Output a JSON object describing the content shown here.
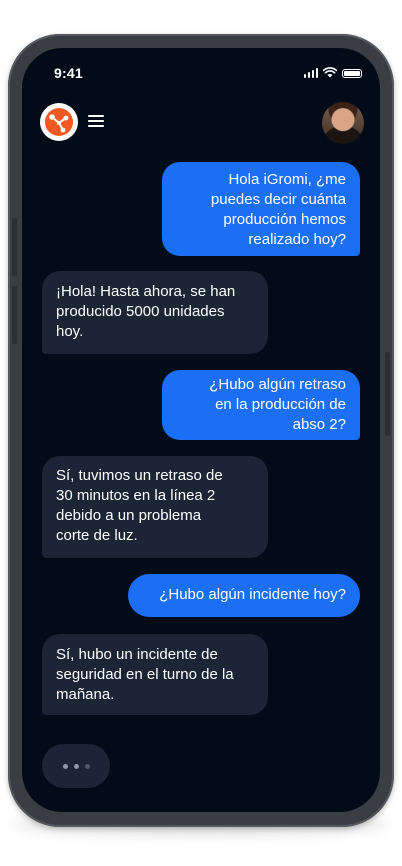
{
  "status_bar": {
    "time": "9:41"
  },
  "header": {
    "logo_icon": "igromi-logo-icon",
    "menu_icon": "hamburger-menu-icon",
    "avatar_icon": "user-avatar"
  },
  "colors": {
    "user_bubble": "#1b6ff5",
    "bot_bubble": "#1b2536",
    "screen_bg": "#020c18",
    "logo_accent": "#f05a22"
  },
  "messages": [
    {
      "sender": "user",
      "text": "Hola iGromi, ¿me\npuedes decir cuánta\nproducción hemos\nrealizado hoy?"
    },
    {
      "sender": "bot",
      "text": "¡Hola! Hasta ahora, se han\nproducido 5000 unidades\nhoy."
    },
    {
      "sender": "user",
      "text": "¿Hubo algún retraso\nen la producción de\nabso 2?"
    },
    {
      "sender": "bot",
      "text": " Sí, tuvimos un retraso de\n30 minutos en la línea 2\ndebido a un problema\ncorte de luz."
    },
    {
      "sender": "user",
      "text": "¿Hubo algún incidente hoy?"
    },
    {
      "sender": "bot",
      "text": "Sí, hubo un incidente de\nseguridad en el turno de la\nmañana."
    }
  ],
  "typing_indicator": {
    "icon": "typing-dots-icon"
  }
}
